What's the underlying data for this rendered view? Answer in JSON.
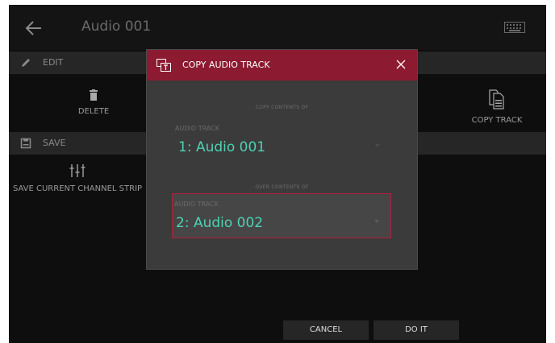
{
  "header": {
    "title": "Audio 001"
  },
  "sections": {
    "edit": {
      "label": "EDIT"
    },
    "save": {
      "label": "SAVE"
    }
  },
  "actions": {
    "delete": "DELETE",
    "copy_track": "COPY TRACK",
    "save_channel_strip": "SAVE CURRENT CHANNEL STRIP"
  },
  "footer": {
    "cancel": "CANCEL",
    "do_it": "DO IT"
  },
  "modal": {
    "title": "COPY AUDIO TRACK",
    "copy_contents_caption": "COPY CONTENTS OF",
    "over_contents_caption": "OVER CONTENTS OF",
    "source": {
      "label": "AUDIO TRACK",
      "value": "1: Audio 001"
    },
    "destination": {
      "label": "AUDIO TRACK",
      "value": "2: Audio 002"
    }
  },
  "colors": {
    "accent": "#8c1a30",
    "value_text": "#4fd1b4",
    "selection_border": "#b0203c"
  },
  "icons": [
    "back-arrow-icon",
    "keyboard-icon",
    "pencil-icon",
    "trash-icon",
    "copy-document-icon",
    "save-disk-icon",
    "channel-strip-icon",
    "copy-track-icon",
    "close-icon",
    "dropdown-caret-icon"
  ]
}
